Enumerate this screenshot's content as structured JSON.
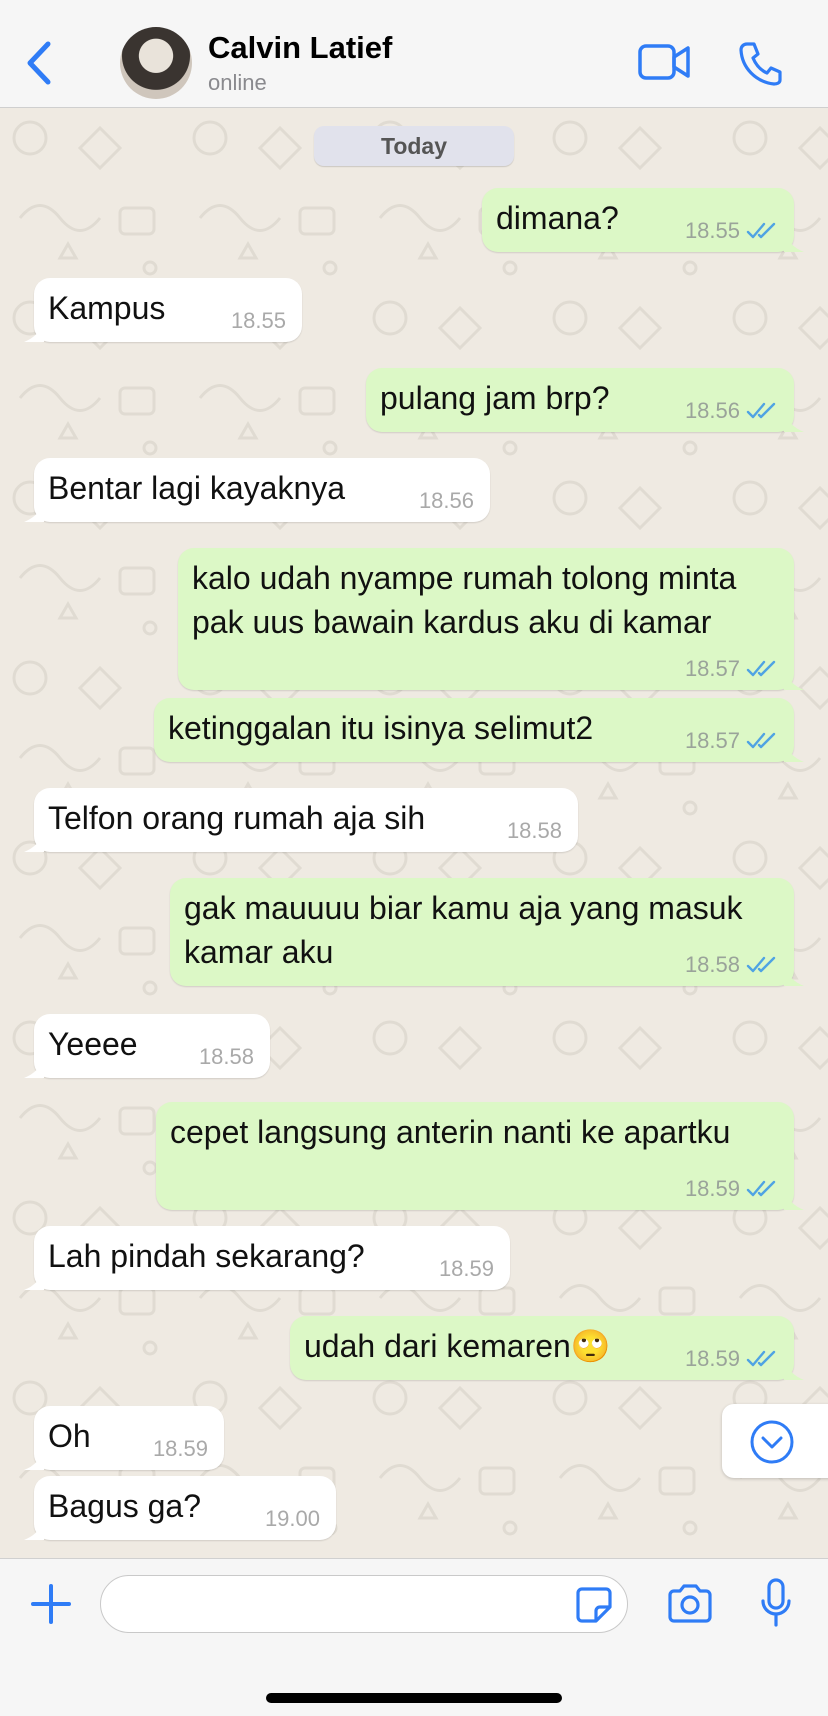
{
  "header": {
    "contact_name": "Calvin Latief",
    "status": "online",
    "accent_color": "#2f7cf6"
  },
  "date_chip": "Today",
  "messages": [
    {
      "dir": "out",
      "text": "dimana?",
      "time": "18.55",
      "read": true
    },
    {
      "dir": "in",
      "text": "Kampus",
      "time": "18.55"
    },
    {
      "dir": "out",
      "text": "pulang jam brp?",
      "time": "18.56",
      "read": true
    },
    {
      "dir": "in",
      "text": "Bentar lagi kayaknya",
      "time": "18.56"
    },
    {
      "dir": "out",
      "text": "kalo udah nyampe rumah tolong minta pak uus bawain kardus aku di kamar",
      "time": "18.57",
      "read": true
    },
    {
      "dir": "out",
      "text": "ketinggalan itu isinya selimut2",
      "time": "18.57",
      "read": true
    },
    {
      "dir": "in",
      "text": "Telfon orang rumah aja sih",
      "time": "18.58"
    },
    {
      "dir": "out",
      "text": "gak mauuuu biar kamu aja yang masuk kamar aku",
      "time": "18.58",
      "read": true
    },
    {
      "dir": "in",
      "text": "Yeeee",
      "time": "18.58"
    },
    {
      "dir": "out",
      "text": "cepet langsung anterin nanti ke apartku",
      "time": "18.59",
      "read": true
    },
    {
      "dir": "in",
      "text": "Lah pindah sekarang?",
      "time": "18.59"
    },
    {
      "dir": "out",
      "text": "udah dari kemaren🙄",
      "time": "18.59",
      "read": true
    },
    {
      "dir": "in",
      "text": "Oh",
      "time": "18.59"
    },
    {
      "dir": "in",
      "text": "Bagus ga?",
      "time": "19.00"
    }
  ],
  "colors": {
    "outgoing_bubble": "#dcf8c6",
    "incoming_bubble": "#ffffff",
    "read_ticks": "#4fa3e3",
    "chat_background": "#efeae2"
  },
  "input": {
    "value": "",
    "placeholder": ""
  },
  "icons": [
    "back-chevron-icon",
    "video-call-icon",
    "phone-icon",
    "scroll-down-icon",
    "plus-icon",
    "sticker-icon",
    "camera-icon",
    "microphone-icon"
  ]
}
